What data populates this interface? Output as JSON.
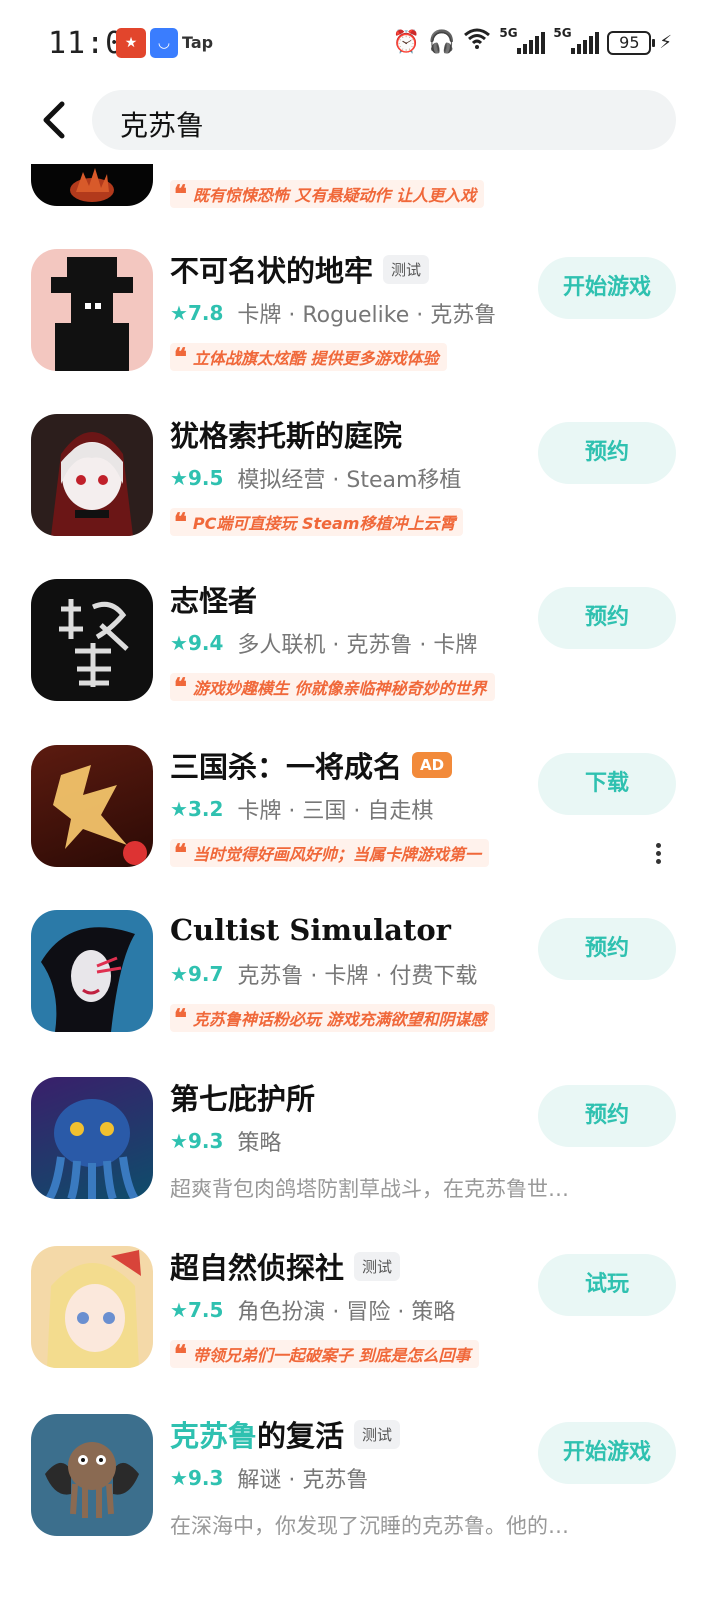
{
  "status_bar": {
    "time": "11:09",
    "notif_3": "Tap",
    "signal_1": "5G",
    "signal_2": "5G",
    "battery": "95"
  },
  "search": {
    "query": "克苏鲁"
  },
  "top_partial": {
    "quote": "既有惊悚恐怖 又有悬疑动作 让人更入戏"
  },
  "games": [
    {
      "title": "不可名状的地牢",
      "tag": "测试",
      "rating": "7.8",
      "categories": "卡牌 · Roguelike · 克苏鲁",
      "quote": "立体战旗太炫酷 提供更多游戏体验",
      "action": "开始游戏"
    },
    {
      "title": "犹格索托斯的庭院",
      "rating": "9.5",
      "categories": "模拟经营 · Steam移植",
      "quote": "PC端可直接玩 Steam移植冲上云霄",
      "action": "预约"
    },
    {
      "title": "志怪者",
      "rating": "9.4",
      "categories": "多人联机 · 克苏鲁 · 卡牌",
      "quote": "游戏妙趣横生 你就像亲临神秘奇妙的世界",
      "action": "预约"
    },
    {
      "title": "三国杀：一将成名",
      "tag": "AD",
      "rating": "3.2",
      "categories": "卡牌 · 三国 · 自走棋",
      "quote": "当时觉得好画风好帅；当属卡牌游戏第一",
      "action": "下载"
    },
    {
      "title": "Cultist Simulator",
      "rating": "9.7",
      "categories": "克苏鲁 · 卡牌 · 付费下载",
      "quote": "克苏鲁神话粉必玩 游戏充满欲望和阴谋感",
      "action": "预约"
    },
    {
      "title": "第七庇护所",
      "rating": "9.3",
      "categories": "策略",
      "description": "超爽背包肉鸽塔防割草战斗，在克苏鲁世…",
      "action": "预约"
    },
    {
      "title": "超自然侦探社",
      "tag": "测试",
      "rating": "7.5",
      "categories": "角色扮演 · 冒险 · 策略",
      "quote": "带领兄弟们一起破案子 到底是怎么回事",
      "action": "试玩"
    },
    {
      "title_highlight": "克苏鲁",
      "title_rest": "的复活",
      "tag": "测试",
      "rating": "9.3",
      "categories": "解谜 · 克苏鲁",
      "description": "在深海中，你发现了沉睡的克苏鲁。他的…",
      "action": "开始游戏"
    }
  ],
  "colors": {
    "accent": "#2fc1b0",
    "quote": "#f0683a",
    "button_bg": "#e9f7f5"
  },
  "icons": {
    "back": "chevron-left-icon",
    "more": "more-vertical-icon",
    "alarm": "alarm-icon",
    "headphones": "headphones-icon",
    "wifi": "wifi-icon"
  }
}
